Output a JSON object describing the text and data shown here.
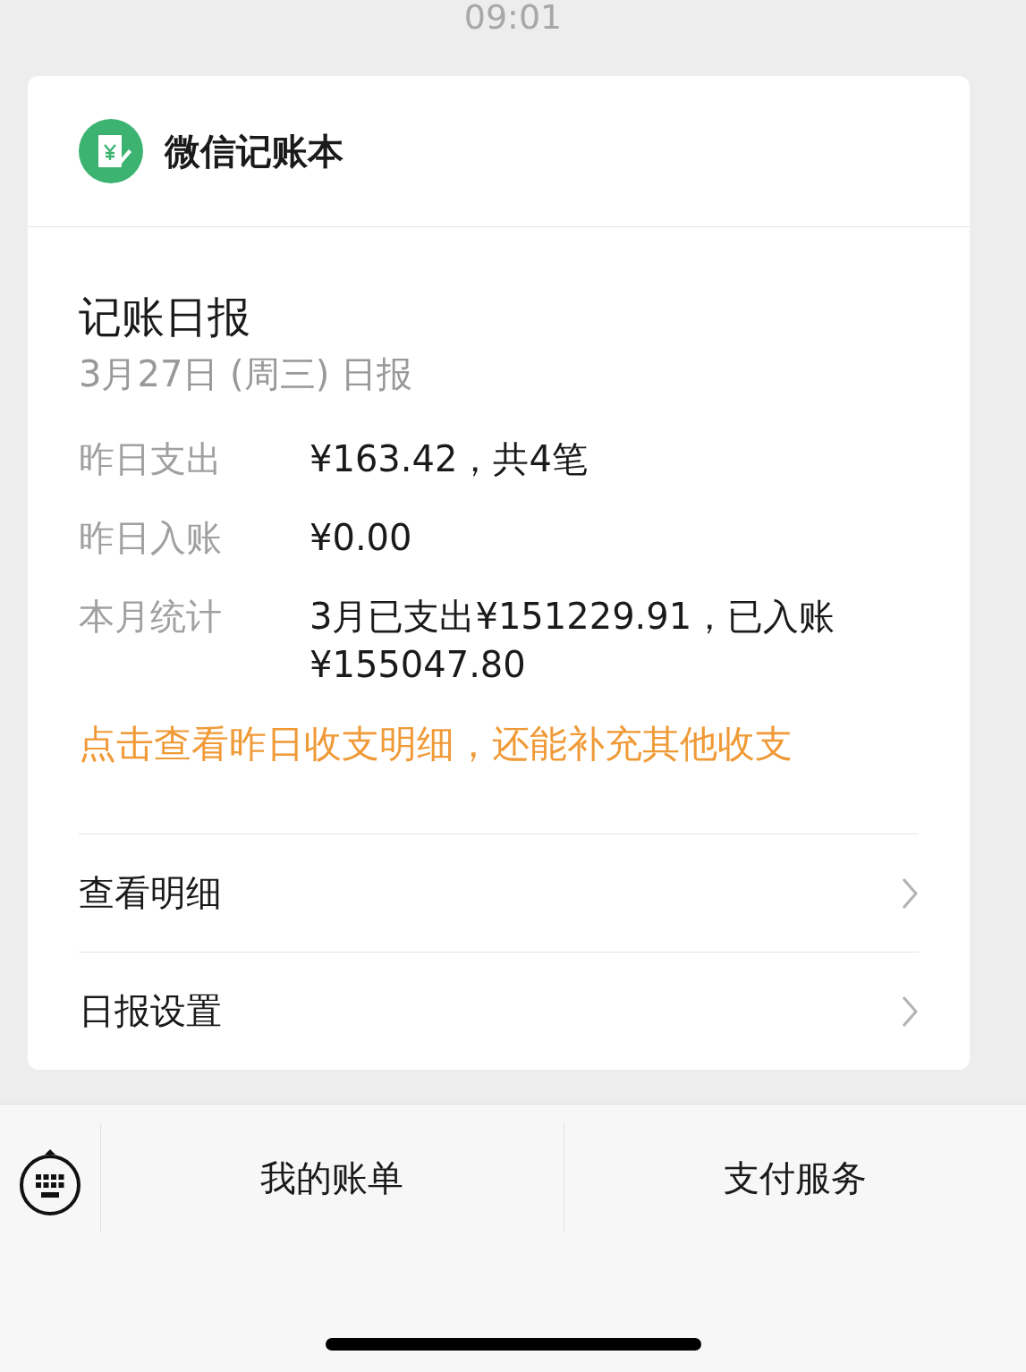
{
  "time": "09:01",
  "card": {
    "app_name": "微信记账本",
    "title": "记账日报",
    "subtitle": "3月27日 (周三) 日报",
    "stats": [
      {
        "label": "昨日支出",
        "value": "¥163.42，共4笔"
      },
      {
        "label": "昨日入账",
        "value": "¥0.00"
      },
      {
        "label": "本月统计",
        "value": "3月已支出¥151229.91，已入账¥155047.80"
      }
    ],
    "link": "点击查看昨日收支明细，还能补充其他收支",
    "menu": [
      {
        "label": "查看明细"
      },
      {
        "label": "日报设置"
      }
    ]
  },
  "bottom_menu": [
    {
      "label": "我的账单"
    },
    {
      "label": "支付服务"
    }
  ]
}
